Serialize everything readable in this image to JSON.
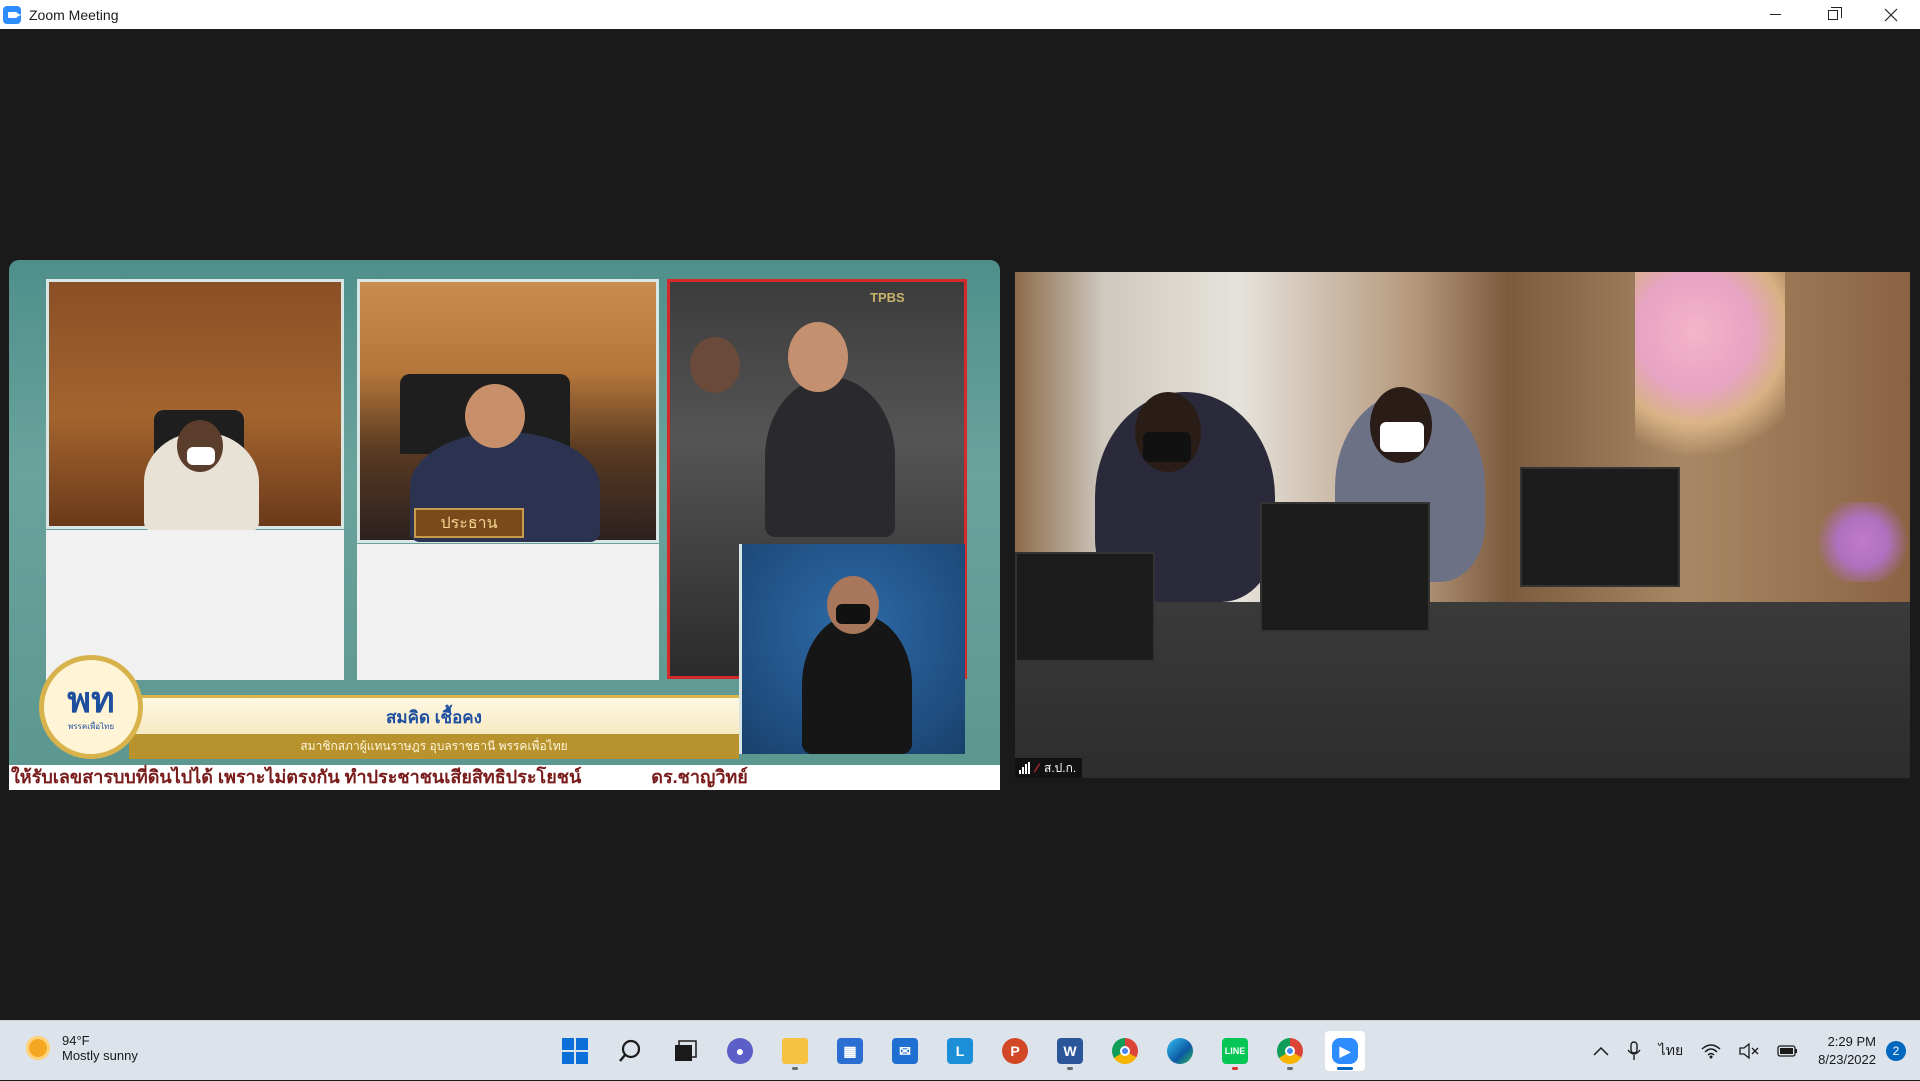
{
  "window": {
    "title": "Zoom Meeting",
    "controls": {
      "minimize": "Minimize",
      "restore": "Restore",
      "close": "Close"
    }
  },
  "meeting": {
    "left_feed": {
      "nameplate": "ประธาน",
      "speaker_name": "สมคิด เชื้อคง",
      "speaker_role": "สมาชิกสภาผู้แทนราษฎร อุบลราชธานี พรรคเพื่อไทย",
      "logo_text": "พท",
      "logo_subtext": "พรรคเพื่อไทย",
      "ticker": "ให้รับเลขสารบบที่ดินไปได้ เพราะไม่ตรงกัน ทำประชาชนเสียสิทธิประโยชน์",
      "ticker_right": "ดร.ชาญวิทย์",
      "channel_badge": "TPBS"
    },
    "right_feed": {
      "participant_name": "ส.ป.ก."
    }
  },
  "taskbar": {
    "weather": {
      "temperature": "94°F",
      "condition": "Mostly sunny"
    },
    "apps": [
      {
        "name": "start",
        "icon": "windows-icon"
      },
      {
        "name": "search",
        "icon": "search-icon"
      },
      {
        "name": "task-view",
        "icon": "task-view-icon"
      },
      {
        "name": "teams-chat",
        "icon": "chat-icon"
      },
      {
        "name": "file-explorer",
        "icon": "folder-icon"
      },
      {
        "name": "store",
        "icon": "store-icon"
      },
      {
        "name": "mail",
        "icon": "mail-icon"
      },
      {
        "name": "l-app",
        "icon": "l-app-icon"
      },
      {
        "name": "powerpoint",
        "icon": "powerpoint-icon"
      },
      {
        "name": "word",
        "icon": "word-icon"
      },
      {
        "name": "chrome",
        "icon": "chrome-icon"
      },
      {
        "name": "edge",
        "icon": "edge-icon"
      },
      {
        "name": "line",
        "icon": "line-icon"
      },
      {
        "name": "chrome-profile",
        "icon": "chrome-icon"
      },
      {
        "name": "zoom",
        "icon": "zoom-icon"
      }
    ],
    "tray": {
      "language": "ไทย",
      "time": "2:29 PM",
      "date": "8/23/2022",
      "notifications": "2"
    }
  },
  "colors": {
    "zoom_blue": "#2d8cff",
    "windows_blue": "#0067c0",
    "meeting_bg": "#1a1a1a"
  }
}
